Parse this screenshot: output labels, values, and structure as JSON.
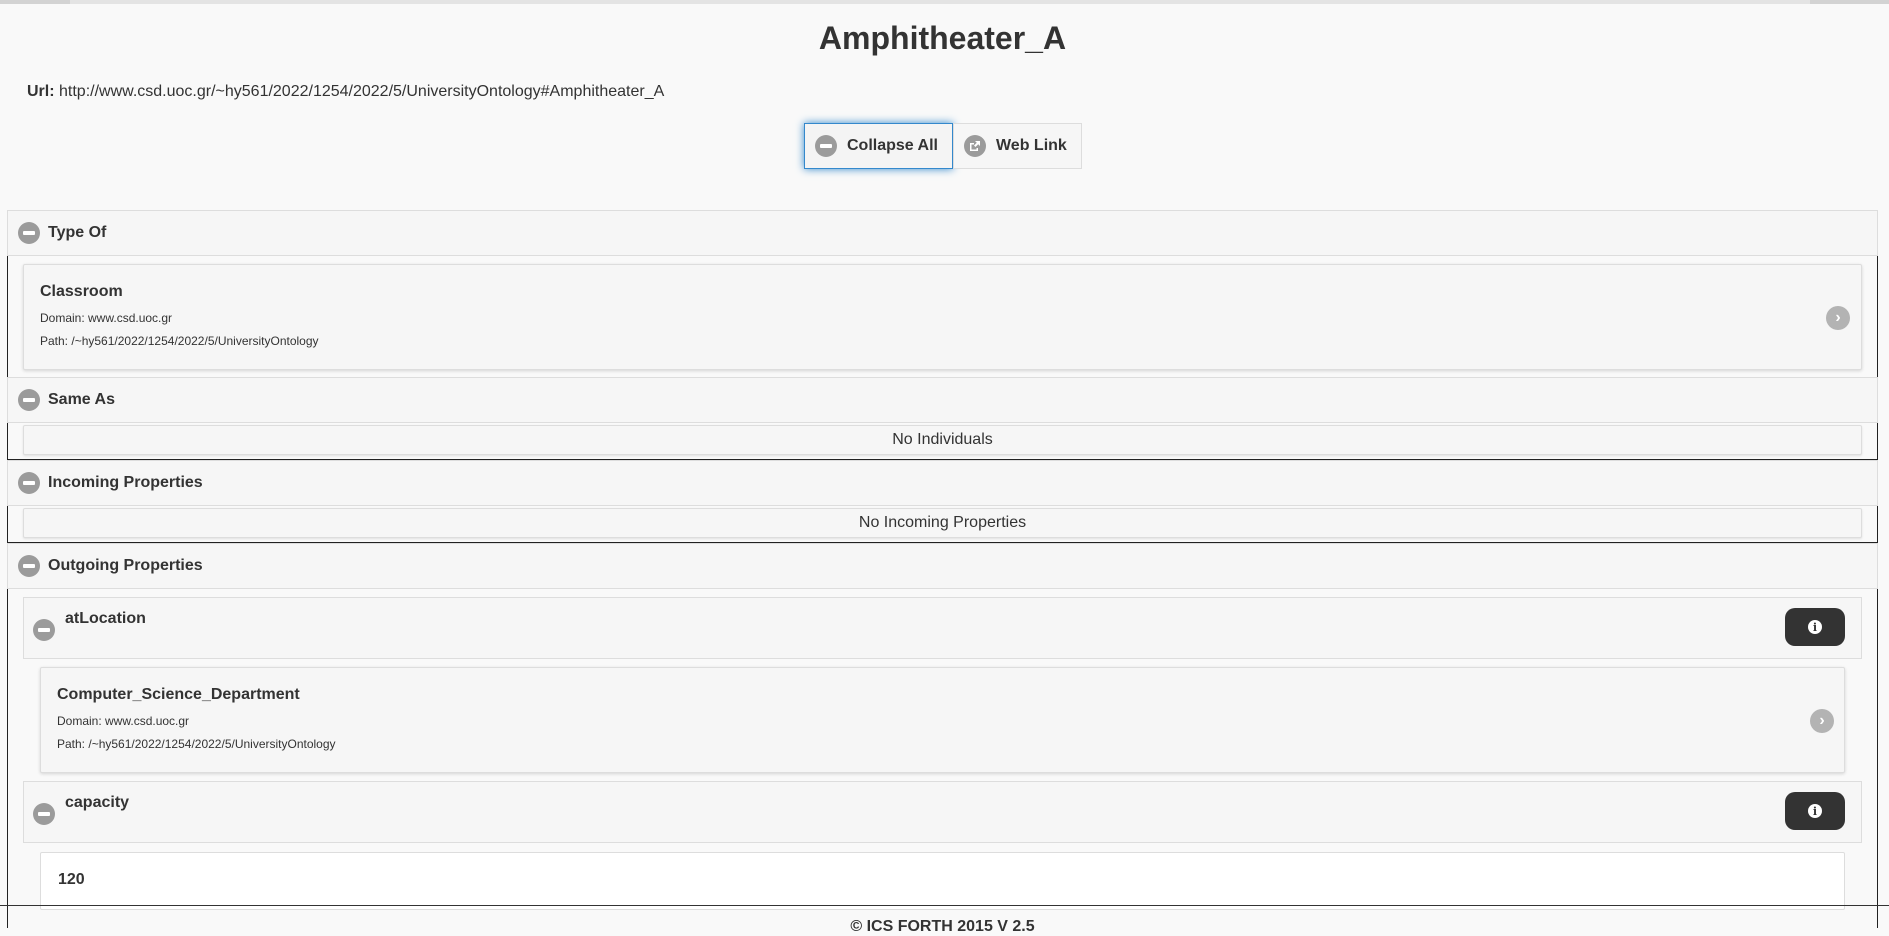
{
  "page": {
    "title": "Amphitheater_A"
  },
  "url": {
    "label": "Url:",
    "value": "http://www.csd.uoc.gr/~hy561/2022/1254/2022/5/UniversityOntology#Amphitheater_A"
  },
  "toolbar": {
    "collapse_label": "Collapse All",
    "weblink_label": "Web Link"
  },
  "sections": {
    "type_of": {
      "label": "Type Of",
      "items": [
        {
          "title": "Classroom",
          "domain": "Domain: www.csd.uoc.gr",
          "path": "Path: /~hy561/2022/1254/2022/5/UniversityOntology"
        }
      ]
    },
    "same_as": {
      "label": "Same As",
      "empty": "No Individuals"
    },
    "incoming": {
      "label": "Incoming Properties",
      "empty": "No Incoming Properties"
    },
    "outgoing": {
      "label": "Outgoing Properties",
      "properties": [
        {
          "name": "atLocation",
          "item": {
            "title": "Computer_Science_Department",
            "domain": "Domain: www.csd.uoc.gr",
            "path": "Path: /~hy561/2022/1254/2022/5/UniversityOntology"
          }
        },
        {
          "name": "capacity",
          "value": "120"
        }
      ]
    }
  },
  "icons": {
    "minus": "minus-circle-icon",
    "share": "share-icon",
    "arrow": "chevron-right-circle-icon",
    "info": "info-icon"
  },
  "colors": {
    "focus": "#3388cc",
    "info_button": "#333333",
    "icon_gray": "#9b9b9b"
  },
  "footer": {
    "text": "© ICS FORTH 2015 V 2.5"
  }
}
